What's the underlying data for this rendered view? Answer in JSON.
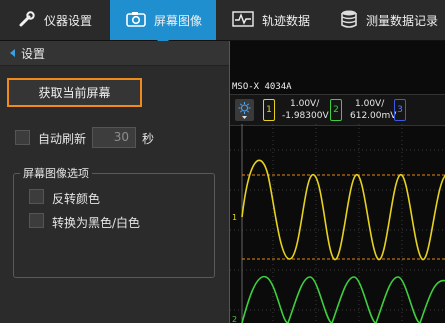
{
  "tabs": [
    {
      "label": "仪器设置",
      "icon": "wrench-icon"
    },
    {
      "label": "屏幕图像",
      "icon": "camera-icon"
    },
    {
      "label": "轨迹数据",
      "icon": "waveform-icon"
    },
    {
      "label": "测量数据记录",
      "icon": "database-icon"
    }
  ],
  "breadcrumb": {
    "label": "设置"
  },
  "capture_button": {
    "label": "获取当前屏幕"
  },
  "auto_refresh": {
    "label": "自动刷新",
    "value": "30",
    "unit": "秒",
    "checked": false
  },
  "screen_options": {
    "title": "屏幕图像选项",
    "invert_colors": {
      "label": "反转颜色",
      "checked": false
    },
    "black_white": {
      "label": "转换为黑色/白色",
      "checked": false
    }
  },
  "scope": {
    "model": "MSO-X  4034A",
    "channels": [
      {
        "number": "1",
        "scale": "1.00V/",
        "offset": "-1.98300V",
        "color": "#e6d21e"
      },
      {
        "number": "2",
        "scale": "1.00V/",
        "offset": "612.00mV",
        "color": "#3ecf3e"
      },
      {
        "number": "3",
        "color": "#3a5adf"
      }
    ],
    "marker1": "1",
    "marker2": "2"
  }
}
